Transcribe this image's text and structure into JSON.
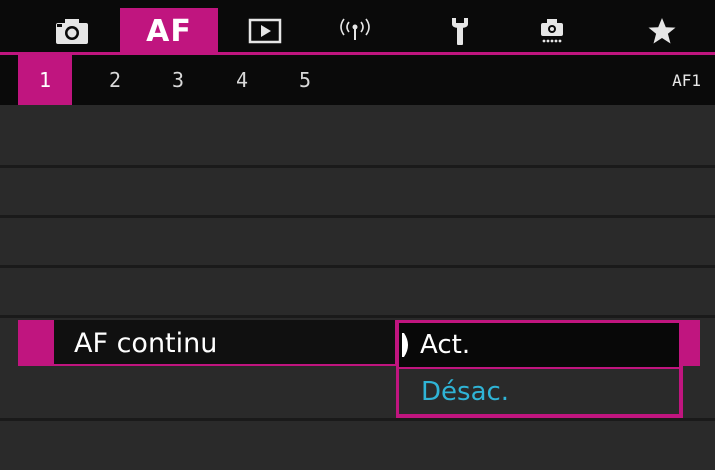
{
  "category_tabs": [
    {
      "icon": "camera-icon"
    },
    {
      "label": "AF",
      "active": true
    },
    {
      "icon": "playback-icon"
    },
    {
      "icon": "wireless-icon"
    },
    {
      "icon": "wrench-icon"
    },
    {
      "icon": "custom-functions-icon"
    },
    {
      "icon": "star-icon"
    }
  ],
  "page_tabs": [
    "1",
    "2",
    "3",
    "4",
    "5"
  ],
  "active_page": "1",
  "page_id": "AF1",
  "menu": {
    "selected_item_label": "AF continu",
    "options": [
      {
        "label": "Act.",
        "current": true
      },
      {
        "label": "Désac.",
        "current": false
      }
    ]
  },
  "colors": {
    "accent": "#c0157f",
    "unselected_option_text": "#2fb4d6",
    "background": "#2a2a2a"
  }
}
